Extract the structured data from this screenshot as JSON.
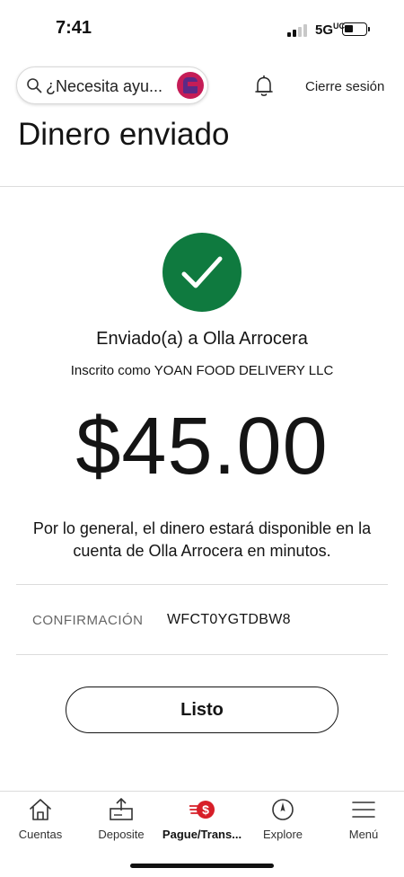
{
  "status_bar": {
    "time": "7:41",
    "network": "5G",
    "network_superscript": "UC"
  },
  "header": {
    "search_placeholder": "¿Necesita ayu...",
    "logout_label": "Cierre sesión",
    "title": "Dinero enviado"
  },
  "confirmation": {
    "sent_to": "Enviado(a) a Olla Arrocera",
    "registered_as": "Inscrito como YOAN FOOD DELIVERY LLC",
    "amount": "$45.00",
    "availability_note": "Por lo general, el dinero estará disponible en la cuenta de Olla Arrocera en minutos.",
    "confirmation_label": "CONFIRMACIÓN",
    "confirmation_code": "WFCT0YGTDBW8",
    "done_button": "Listo",
    "success_color": "#0f7a3f"
  },
  "bottom_nav": {
    "items": [
      {
        "label": "Cuentas",
        "icon": "home-icon"
      },
      {
        "label": "Deposite",
        "icon": "deposit-icon"
      },
      {
        "label": "Pague/Trans...",
        "icon": "pay-transfer-icon",
        "active": true
      },
      {
        "label": "Explore",
        "icon": "compass-icon"
      },
      {
        "label": "Menú",
        "icon": "menu-icon"
      }
    ],
    "accent_color": "#d71e28"
  }
}
